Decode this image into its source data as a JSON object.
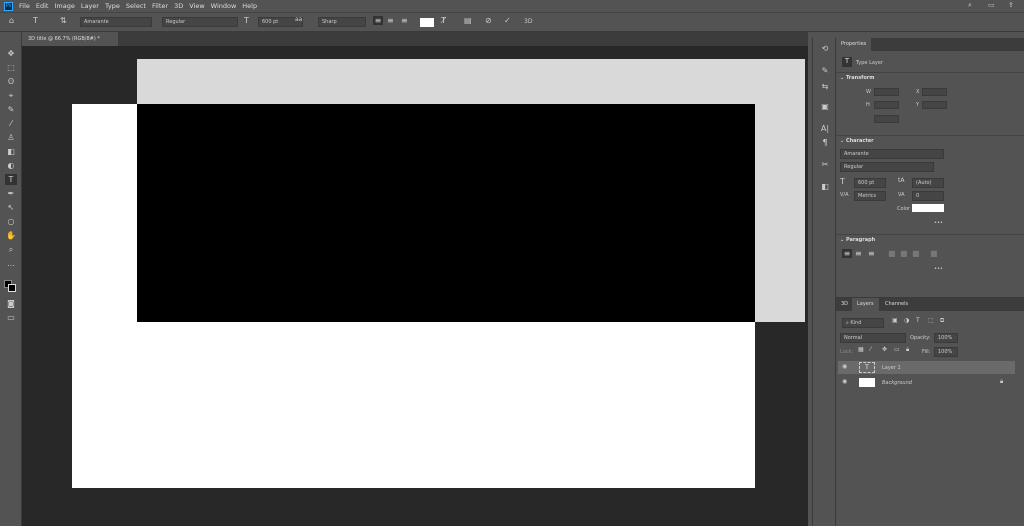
{
  "app": {
    "logo": "Ps",
    "menu": [
      "File",
      "Edit",
      "Image",
      "Layer",
      "Type",
      "Select",
      "Filter",
      "3D",
      "View",
      "Window",
      "Help"
    ]
  },
  "options": {
    "font_family": "Amarante",
    "font_style": "Regular",
    "font_size": "600 pt",
    "antialias": "Sharp",
    "color": "#ffffff",
    "threed_label": "3D"
  },
  "document": {
    "tab_title": "3D title @ 66.7% (RGB/8#) *"
  },
  "properties": {
    "tab": "Properties",
    "layer_type": "Type Layer",
    "transform_label": "Transform",
    "w_label": "W",
    "h_label": "H",
    "x_label": "X",
    "y_label": "Y",
    "character_label": "Character",
    "font_family": "Amarante",
    "font_style": "Regular",
    "font_size": "600 pt",
    "leading": "(Auto)",
    "kerning": "Metrics",
    "tracking": "0",
    "color_label": "Color",
    "color": "#ffffff",
    "paragraph_label": "Paragraph",
    "more": "•••"
  },
  "layers": {
    "tabs": [
      "3D",
      "Layers",
      "Channels"
    ],
    "active_tab": "Layers",
    "filter_placeholder": "Kind",
    "blend_mode": "Normal",
    "opacity_label": "Opacity:",
    "opacity": "100%",
    "lock_label": "Lock:",
    "fill_label": "Fill:",
    "fill": "100%",
    "items": [
      {
        "name": "Layer 1",
        "type": "text",
        "selected": true
      },
      {
        "name": "Background",
        "type": "raster",
        "locked": true
      }
    ]
  },
  "colors": {
    "canvas_bg": "#282828",
    "panel": "#535353",
    "document_white": "#ffffff",
    "artboard_gray": "#d9d9d9",
    "black_fill": "#000000"
  }
}
